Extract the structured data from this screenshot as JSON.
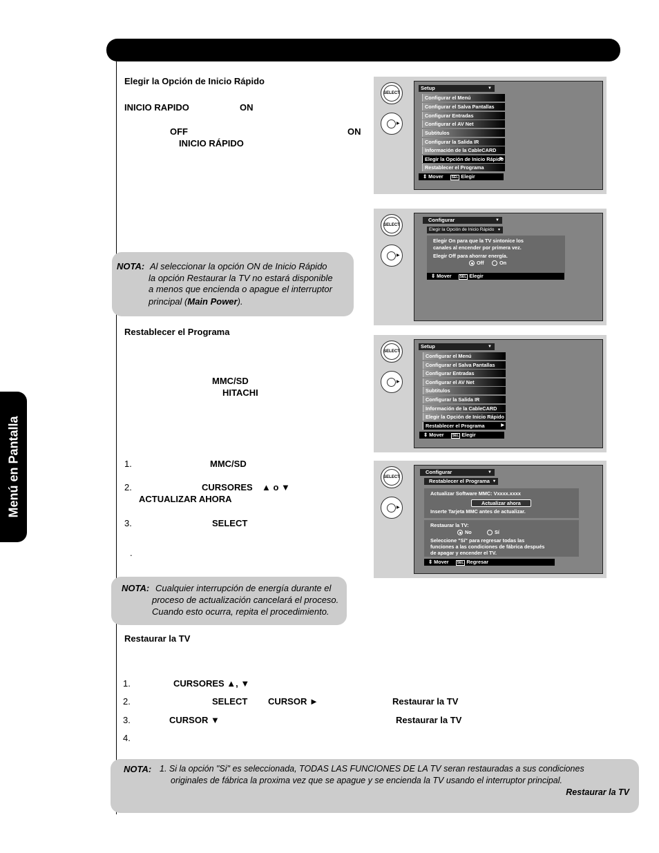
{
  "side_tab": {
    "label": "Menú en Pantalla"
  },
  "section1": {
    "heading": "Elegir la Opción de Inicio Rápido",
    "line1_a": "INICIO RAPIDO",
    "line1_b": "ON",
    "line2_a": "OFF",
    "line2_b": "ON",
    "line3": "INICIO RÁPIDO"
  },
  "note1": {
    "label": "NOTA:",
    "line1": "Al seleccionar la opción ON de Inicio Rápido",
    "line2": "la opción Restaurar la TV no estará disponible",
    "line3": "a menos que encienda o apague el interruptor",
    "line4_a": "principal (",
    "line4_b": "Main Power",
    "line4_c": ")."
  },
  "section2": {
    "heading": "Restablecer el Programa",
    "mmc": "MMC/SD",
    "hitachi": "HITACHI",
    "steps": [
      {
        "num": "1.",
        "bold": "MMC/SD"
      },
      {
        "num": "2.",
        "bold": "CURSORES",
        "arrows": "▲  o  ▼",
        "bold2": "ACTUALIZAR AHORA"
      },
      {
        "num": "3.",
        "bold": "SELECT"
      }
    ],
    "dot": "."
  },
  "note2": {
    "label": "NOTA:",
    "line1": "Cualquier interrupción de energía durante el",
    "line2": "proceso de actualización cancelará el proceso.",
    "line3": "Cuando esto ocurra, repita el procedimiento."
  },
  "section3": {
    "heading": "Restaurar la TV",
    "steps": [
      {
        "num": "1.",
        "bold": "CURSORES ▲, ▼"
      },
      {
        "num": "2.",
        "bold": "SELECT",
        "bold2": "CURSOR ►",
        "bold3": "Restaurar la TV"
      },
      {
        "num": "3.",
        "bold": "CURSOR ▼",
        "bold3": "Restaurar la TV"
      },
      {
        "num": "4."
      }
    ]
  },
  "note3": {
    "label": "NOTA:",
    "line1": "1. Si la opción \"Si\" es seleccionada, TODAS LAS FUNCIONES DE LA TV seran restauradas a sus condiciones",
    "line2": "originales de fábrica la proxima vez que se apague y se encienda la TV usando el interruptor principal.",
    "line3": "Restaurar la TV"
  },
  "remote": {
    "select_label": "SELECT",
    "sel_key": "SEL"
  },
  "panel1": {
    "title": "Setup",
    "items": [
      "Configurar el Menú",
      "Configurar el Salva Pantallas",
      "Configurar Entradas",
      "Configurar el AV Net",
      "Subtitulos",
      "Configurar la Salida IR",
      "Información de la CableCARD",
      "Elegir la Opción de Inicio Rápido",
      "Restablecer el Programa"
    ],
    "selected_index": 7,
    "footer_move": "Mover",
    "footer_action": "Elegir"
  },
  "panel2": {
    "title": "Configurar",
    "subtitle": "Elegir la Opción de Inicio Rápido",
    "line1": "Elegir On para que la TV sintonice los",
    "line2": "canales al encender por primera vez.",
    "line3": "Elegir Off para ahorrar energía.",
    "option_off": "Off",
    "option_on": "On",
    "selected": "Off",
    "footer_move": "Mover",
    "footer_action": "Elegir"
  },
  "panel3": {
    "title": "Setup",
    "items": [
      "Configurar el Menú",
      "Configurar el Salva Pantallas",
      "Configurar Entradas",
      "Configurar el AV Net",
      "Subtitulos",
      "Configurar la Salida IR",
      "Información de la CableCARD",
      "Elegir la Opción de Inicio Rápido",
      "Restablecer el Programa"
    ],
    "selected_index": 8,
    "footer_move": "Mover",
    "footer_action": "Elegir"
  },
  "panel4": {
    "title": "Configurar",
    "subtitle": "Restablecer el Programa",
    "software_label": "Actualizar Software MMC:  Vxxxx.xxxx",
    "update_button": "Actualizar ahora",
    "insert_text": "Inserte Tarjeta MMC antes de actualizar.",
    "restore_label": "Restaurar la TV:",
    "option_no": "No",
    "option_si": "Sí",
    "selected": "No",
    "desc1": "Seleccione \"Sí\" para regresar todas las",
    "desc2": "funciones a las condiciones de fábrica después",
    "desc3": "de apagar y encender el TV.",
    "footer_move": "Mover",
    "footer_action": "Regresar"
  }
}
